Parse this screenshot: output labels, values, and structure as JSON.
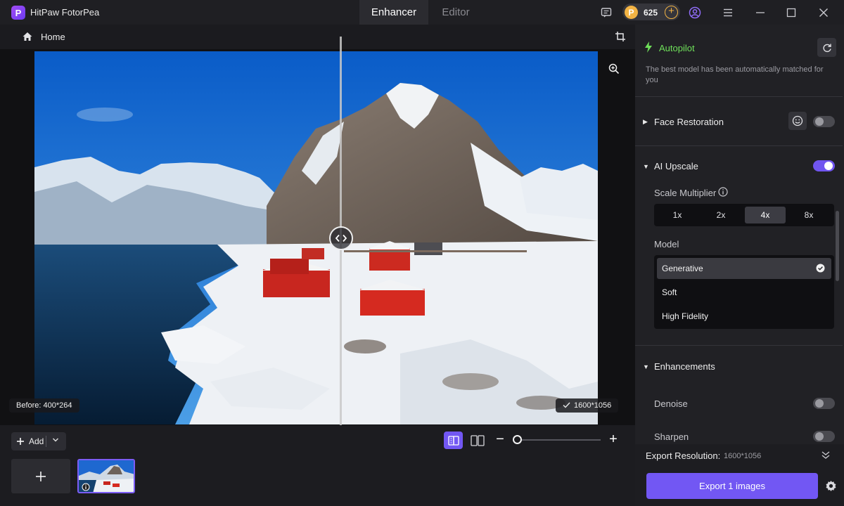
{
  "app": {
    "title": "HitPaw FotorPea",
    "logo_letter": "P"
  },
  "tabs": [
    {
      "label": "Enhancer",
      "active": true
    },
    {
      "label": "Editor",
      "active": false
    }
  ],
  "titlebar": {
    "coins": "625"
  },
  "breadcrumb": {
    "home_label": "Home"
  },
  "canvas": {
    "before_label": "Before: 400*264",
    "after_label": "1600*1056",
    "handle_icon": "‹›"
  },
  "tray": {
    "add_label": "Add"
  },
  "autopilot": {
    "label": "Autopilot",
    "description": "The best model has been automatically matched for you"
  },
  "sections": {
    "face_restoration": {
      "label": "Face Restoration",
      "enabled": false
    },
    "ai_upscale": {
      "label": "AI Upscale",
      "enabled": true
    },
    "enhancements": {
      "label": "Enhancements"
    }
  },
  "scale": {
    "label": "Scale Multiplier",
    "options": [
      "1x",
      "2x",
      "4x",
      "8x"
    ],
    "selected": "4x"
  },
  "model": {
    "label": "Model",
    "options": [
      "Generative",
      "Soft",
      "High Fidelity"
    ],
    "selected": "Generative"
  },
  "enhancements": {
    "denoise": {
      "label": "Denoise",
      "enabled": false
    },
    "sharpen": {
      "label": "Sharpen",
      "enabled": false
    }
  },
  "export": {
    "resolution_label": "Export Resolution:",
    "resolution_value": "1600*1056",
    "button_label": "Export 1 images"
  },
  "colors": {
    "accent": "#7257f3",
    "autopilot": "#6fe05a",
    "coin": "#f2b344"
  }
}
